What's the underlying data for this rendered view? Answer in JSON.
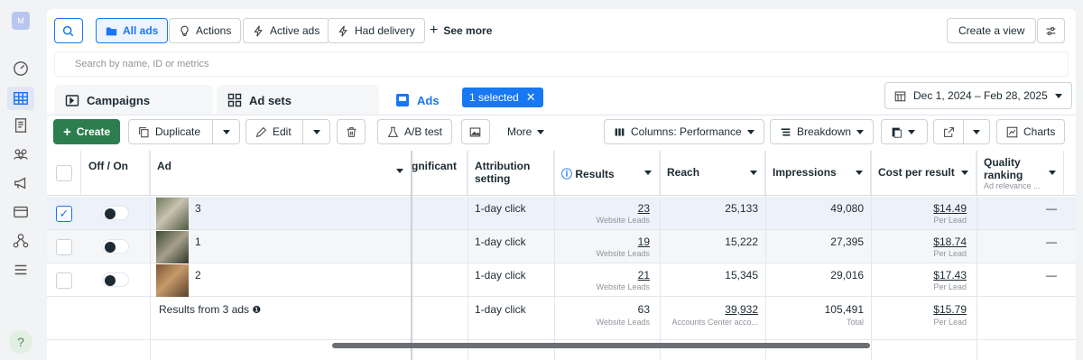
{
  "rail": {
    "avatar": "M",
    "help": "?"
  },
  "toolbar1": {
    "all_ads": "All ads",
    "actions": "Actions",
    "active_ads": "Active ads",
    "had_delivery": "Had delivery",
    "see_more": "See more",
    "create_view": "Create a view"
  },
  "search": {
    "placeholder": "Search by name, ID or metrics"
  },
  "tabs": {
    "campaigns": "Campaigns",
    "ad_sets": "Ad sets",
    "ads": "Ads",
    "selected": "1 selected",
    "date_range": "Dec 1, 2024 – Feb 28, 2025"
  },
  "toolbar2": {
    "create": "Create",
    "duplicate": "Duplicate",
    "edit": "Edit",
    "ab_test": "A/B test",
    "more": "More",
    "columns": "Columns: Performance",
    "breakdown": "Breakdown",
    "charts": "Charts"
  },
  "table": {
    "headers": {
      "off_on": "Off / On",
      "ad": "Ad",
      "significant": "gnificant",
      "attribution": "Attribution setting",
      "results": "Results",
      "reach": "Reach",
      "impressions": "Impressions",
      "cost_per_result": "Cost per result",
      "quality": "Quality ranking",
      "quality_sub": "Ad relevance ..."
    },
    "rows": [
      {
        "ad": "3",
        "attribution": "1-day click",
        "results": "23",
        "results_sub": "Website Leads",
        "reach": "25,133",
        "impressions": "49,080",
        "cost": "$14.49",
        "cost_sub": "Per Lead",
        "quality": "—",
        "checked": true
      },
      {
        "ad": "1",
        "attribution": "1-day click",
        "results": "19",
        "results_sub": "Website Leads",
        "reach": "15,222",
        "impressions": "27,395",
        "cost": "$18.74",
        "cost_sub": "Per Lead",
        "quality": "—",
        "checked": false
      },
      {
        "ad": "2",
        "attribution": "1-day click",
        "results": "21",
        "results_sub": "Website Leads",
        "reach": "15,345",
        "impressions": "29,016",
        "cost": "$17.43",
        "cost_sub": "Per Lead",
        "quality": "—",
        "checked": false
      }
    ],
    "summary": {
      "label": "Results from 3 ads",
      "attribution": "1-day click",
      "results": "63",
      "results_sub": "Website Leads",
      "reach": "39,932",
      "reach_sub": "Accounts Center acco...",
      "impressions": "105,491",
      "impressions_sub": "Total",
      "cost": "$15.79",
      "cost_sub": "Per Lead"
    }
  },
  "colors": {
    "accent": "#1877f2",
    "create_green": "#2e7d4f",
    "selected_row": "#edf1fa"
  }
}
